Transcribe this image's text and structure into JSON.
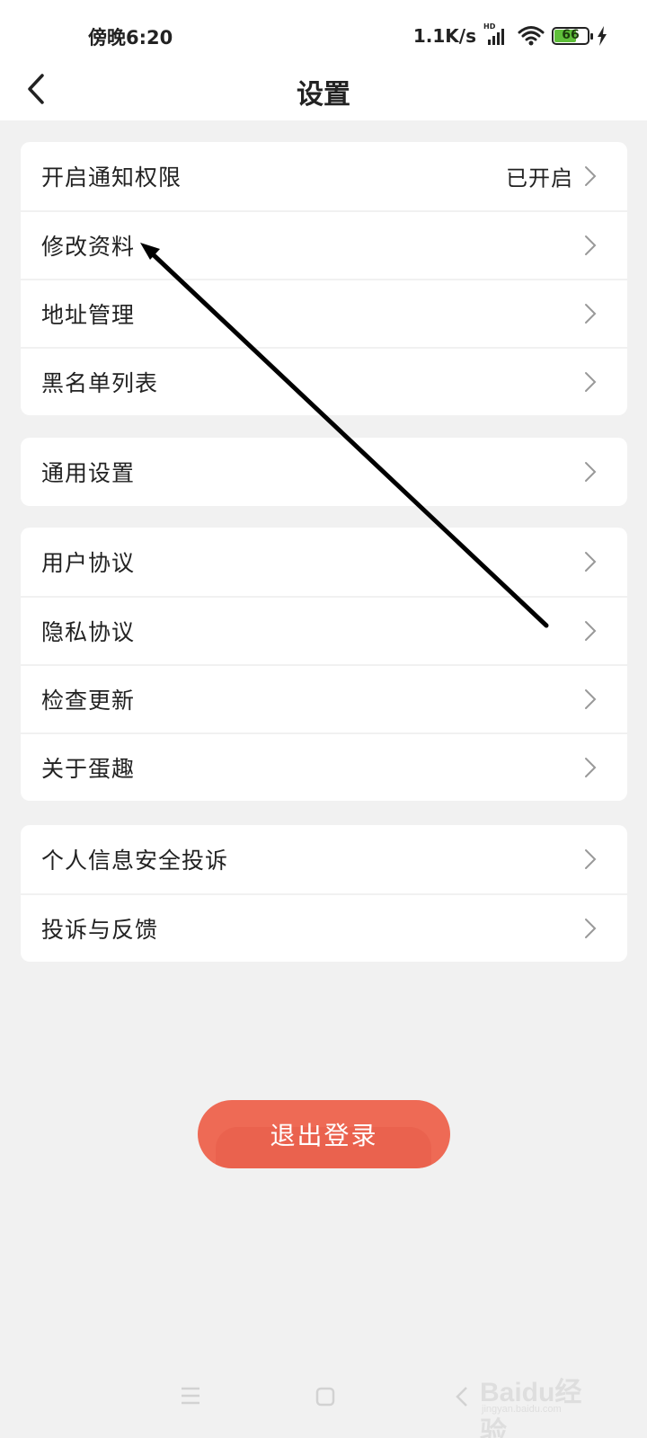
{
  "status_bar": {
    "time": "傍晚6:20",
    "net_speed": "1.1K/s",
    "signal_tag": "HD",
    "battery_level": "66"
  },
  "header": {
    "title": "设置"
  },
  "groups": [
    {
      "rows": [
        {
          "label": "开启通知权限",
          "value": "已开启"
        },
        {
          "label": "修改资料"
        },
        {
          "label": "地址管理"
        },
        {
          "label": "黑名单列表"
        }
      ]
    },
    {
      "rows": [
        {
          "label": "通用设置"
        }
      ]
    },
    {
      "rows": [
        {
          "label": "用户协议"
        },
        {
          "label": "隐私协议"
        },
        {
          "label": "检查更新"
        },
        {
          "label": "关于蛋趣"
        }
      ]
    },
    {
      "rows": [
        {
          "label": "个人信息安全投诉"
        },
        {
          "label": "投诉与反馈"
        }
      ]
    }
  ],
  "logout": {
    "label": "退出登录",
    "color": "#ee6a55"
  },
  "watermark": {
    "brand": "Baidu经验",
    "site": "jingyan.baidu.com"
  },
  "icons": {
    "back": "chevron-left-icon",
    "row_arrow": "chevron-right-icon",
    "wifi": "wifi-icon",
    "signal": "signal-icon",
    "battery": "battery-icon",
    "charging": "lightning-icon"
  }
}
